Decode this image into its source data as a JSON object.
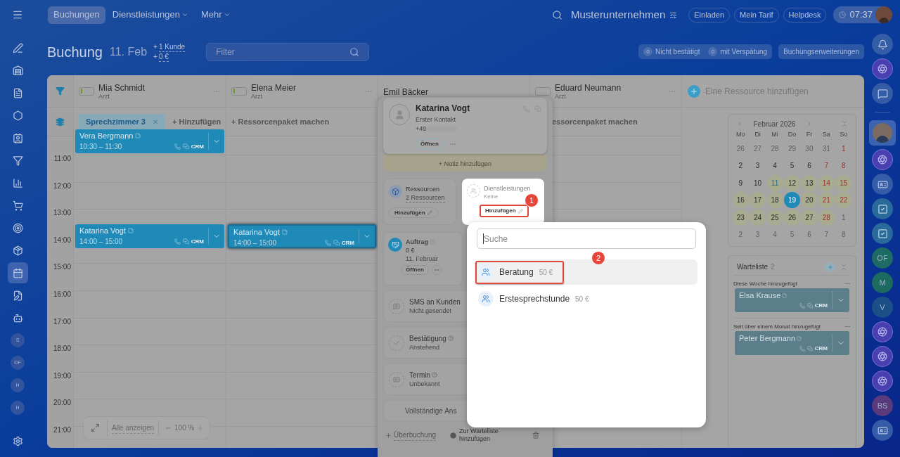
{
  "top_bar": {
    "tabs": [
      {
        "label": "Buchungen",
        "selected": true,
        "has_menu": false
      },
      {
        "label": "Dienstleistungen",
        "selected": false,
        "has_menu": true
      },
      {
        "label": "Mehr",
        "selected": false,
        "has_menu": true
      }
    ],
    "company": "Musterunternehmen",
    "buttons": [
      "Einladen",
      "Mein Tarif",
      "Helpdesk"
    ],
    "clock": "07:37"
  },
  "left_nav": [
    {
      "kind": "icon",
      "selected": false
    },
    {
      "kind": "icon",
      "selected": false
    },
    {
      "kind": "icon",
      "selected": false
    },
    {
      "kind": "icon",
      "selected": false
    },
    {
      "kind": "icon",
      "selected": false
    },
    {
      "kind": "icon",
      "selected": false
    },
    {
      "kind": "icon",
      "selected": false
    },
    {
      "kind": "icon",
      "selected": false
    },
    {
      "kind": "icon",
      "selected": false
    },
    {
      "kind": "icon",
      "selected": false
    },
    {
      "kind": "icon",
      "selected": true
    },
    {
      "kind": "icon",
      "selected": false
    },
    {
      "kind": "icon",
      "selected": false
    },
    {
      "kind": "avatar",
      "label": "S",
      "selected": false
    },
    {
      "kind": "avatar",
      "label": "DF",
      "selected": false
    },
    {
      "kind": "avatar",
      "label": "H",
      "selected": false
    },
    {
      "kind": "avatar",
      "label": "H",
      "selected": false
    }
  ],
  "right_nav": [
    {
      "kind": "bell",
      "selected": false
    },
    {
      "kind": "swirl",
      "selected": false
    },
    {
      "kind": "chat",
      "selected": false
    },
    {
      "kind": "divider"
    },
    {
      "kind": "person",
      "selected": true
    },
    {
      "kind": "swirl",
      "selected": false
    },
    {
      "kind": "card",
      "selected": false
    },
    {
      "kind": "task",
      "selected": false
    },
    {
      "kind": "task",
      "selected": false
    },
    {
      "kind": "avatar",
      "label": "OF",
      "color": "#1d6b62",
      "selected": false
    },
    {
      "kind": "avatar",
      "label": "M",
      "color": "#1d6a5e",
      "selected": false
    },
    {
      "kind": "avatar",
      "label": "V",
      "color": "#1c4f86",
      "selected": false
    },
    {
      "kind": "swirl",
      "selected": false
    },
    {
      "kind": "swirl",
      "selected": false
    },
    {
      "kind": "swirl",
      "selected": false
    },
    {
      "kind": "avatar",
      "label": "BS",
      "color": "#5a3a7a",
      "selected": false
    },
    {
      "kind": "card",
      "selected": false
    }
  ],
  "header": {
    "title": "Buchung",
    "date": "11. Feb",
    "stats": [
      {
        "prefix": "+",
        "value": "1 Kunde"
      },
      {
        "prefix": "+",
        "value": "0 €"
      }
    ],
    "filter_placeholder": "Filter",
    "counters": [
      {
        "count": "0",
        "label": "Nicht bestätigt"
      },
      {
        "count": "0",
        "label": "mit Verspätung"
      }
    ],
    "extensions_button": "Buchungserweiterungen"
  },
  "schedule": {
    "resources": [
      {
        "name": "Mia Schmidt",
        "role": "Arzt",
        "level": 0.12,
        "events": [
          {
            "name": "Vera Bergmann",
            "time": "10:30 – 11:30",
            "crm": "CRM",
            "selected": false
          },
          {
            "name": "Katarina Vogt",
            "time": "14:00 – 15:00",
            "crm": "CRM",
            "selected": false
          }
        ]
      },
      {
        "name": "Elena Meier",
        "role": "Arzt",
        "level": 0.12,
        "package_text": "+ Ressorcenpaket machen",
        "events": [
          {
            "name": "Katarina Vogt",
            "time": "14:00 – 15:00",
            "crm": "CRM",
            "selected": true
          }
        ]
      },
      {
        "name": "Emil Bäcker"
      },
      {
        "name": "Eduard Neumann",
        "role": "Arzt",
        "package_text": "essorcenpaket machen"
      }
    ],
    "package_chip": "Sprechzimmer 3",
    "chip_close": "✕",
    "add_to_package": "+ Hinzufügen",
    "add_resource": "Eine Ressource hinzufügen",
    "times": [
      "11:00",
      "12:00",
      "13:00",
      "14:00",
      "15:00",
      "16:00",
      "17:00",
      "18:00",
      "19:00",
      "20:00",
      "21:00"
    ],
    "show_all": "Alle anzeigen",
    "zoom": "100 %"
  },
  "calendar": {
    "title": "Februar 2026",
    "weekdays": [
      "Mo",
      "Di",
      "Mi",
      "Do",
      "Fr",
      "Sa",
      "So"
    ],
    "days": [
      {
        "day": "26",
        "outside": true,
        "busy": false,
        "today": false,
        "selected": false
      },
      {
        "day": "27",
        "outside": true,
        "busy": false,
        "today": false,
        "selected": false
      },
      {
        "day": "28",
        "outside": true,
        "busy": false,
        "today": false,
        "selected": false
      },
      {
        "day": "29",
        "outside": true,
        "busy": false,
        "today": false,
        "selected": false
      },
      {
        "day": "30",
        "outside": true,
        "busy": false,
        "today": false,
        "selected": false
      },
      {
        "day": "31",
        "outside": true,
        "busy": false,
        "today": false,
        "selected": false
      },
      {
        "day": "1",
        "outside": false,
        "busy": false,
        "today": false,
        "selected": false
      },
      {
        "day": "2",
        "outside": false,
        "busy": false,
        "today": false,
        "selected": false
      },
      {
        "day": "3",
        "outside": false,
        "busy": false,
        "today": false,
        "selected": false
      },
      {
        "day": "4",
        "outside": false,
        "busy": false,
        "today": false,
        "selected": false
      },
      {
        "day": "5",
        "outside": false,
        "busy": false,
        "today": false,
        "selected": false
      },
      {
        "day": "6",
        "outside": false,
        "busy": false,
        "today": false,
        "selected": false
      },
      {
        "day": "7",
        "outside": false,
        "busy": false,
        "today": false,
        "selected": false
      },
      {
        "day": "8",
        "outside": false,
        "busy": false,
        "today": false,
        "selected": false
      },
      {
        "day": "9",
        "outside": false,
        "busy": false,
        "today": false,
        "selected": false
      },
      {
        "day": "10",
        "outside": false,
        "busy": false,
        "today": false,
        "selected": false
      },
      {
        "day": "11",
        "outside": false,
        "busy": true,
        "today": true,
        "selected": false
      },
      {
        "day": "12",
        "outside": false,
        "busy": true,
        "today": false,
        "selected": false
      },
      {
        "day": "13",
        "outside": false,
        "busy": true,
        "today": false,
        "selected": false
      },
      {
        "day": "14",
        "outside": false,
        "busy": true,
        "today": false,
        "selected": false
      },
      {
        "day": "15",
        "outside": false,
        "busy": true,
        "today": false,
        "selected": false
      },
      {
        "day": "16",
        "outside": false,
        "busy": true,
        "today": false,
        "selected": false
      },
      {
        "day": "17",
        "outside": false,
        "busy": true,
        "today": false,
        "selected": false
      },
      {
        "day": "18",
        "outside": false,
        "busy": true,
        "today": false,
        "selected": false
      },
      {
        "day": "19",
        "outside": false,
        "busy": false,
        "today": false,
        "selected": true
      },
      {
        "day": "20",
        "outside": false,
        "busy": true,
        "today": false,
        "selected": false
      },
      {
        "day": "21",
        "outside": false,
        "busy": true,
        "today": false,
        "selected": false
      },
      {
        "day": "22",
        "outside": false,
        "busy": true,
        "today": false,
        "selected": false
      },
      {
        "day": "23",
        "outside": false,
        "busy": true,
        "today": false,
        "selected": false
      },
      {
        "day": "24",
        "outside": false,
        "busy": true,
        "today": false,
        "selected": false
      },
      {
        "day": "25",
        "outside": false,
        "busy": true,
        "today": false,
        "selected": false
      },
      {
        "day": "26",
        "outside": false,
        "busy": true,
        "today": false,
        "selected": false
      },
      {
        "day": "27",
        "outside": false,
        "busy": true,
        "today": false,
        "selected": false
      },
      {
        "day": "28",
        "outside": false,
        "busy": true,
        "today": false,
        "selected": false
      },
      {
        "day": "1",
        "outside": true,
        "busy": false,
        "today": false,
        "selected": false
      },
      {
        "day": "2",
        "outside": true,
        "busy": false,
        "today": false,
        "selected": false
      },
      {
        "day": "3",
        "outside": true,
        "busy": false,
        "today": false,
        "selected": false
      },
      {
        "day": "4",
        "outside": true,
        "busy": false,
        "today": false,
        "selected": false
      },
      {
        "day": "5",
        "outside": true,
        "busy": false,
        "today": false,
        "selected": false
      },
      {
        "day": "6",
        "outside": true,
        "busy": false,
        "today": false,
        "selected": false
      },
      {
        "day": "7",
        "outside": true,
        "busy": false,
        "today": false,
        "selected": false
      },
      {
        "day": "8",
        "outside": true,
        "busy": false,
        "today": false,
        "selected": false
      }
    ]
  },
  "waitlist": {
    "title": "Warteliste",
    "count": "2",
    "groups": [
      {
        "label": "Diese Woche hinzugefügt",
        "items": [
          {
            "name": "Elsa Krause",
            "crm": "CRM"
          }
        ]
      },
      {
        "label": "Seit über einem Monat hinzugefügt",
        "items": [
          {
            "name": "Peter Bergmann",
            "crm": "CRM"
          }
        ]
      }
    ]
  },
  "booking_popup": {
    "client": {
      "name": "Katarina Vogt",
      "subtitle": "Erster Kontakt",
      "phone": "+49",
      "open_button": "Öffnen"
    },
    "note_button": "+ Notiz hinzufügen",
    "resources_tile": {
      "title": "Ressourcen",
      "value": "2 Ressourcen",
      "button": "Hinzufügen"
    },
    "services_tile": {
      "title": "Dienstleistungen",
      "value": "Keine",
      "button": "Hinzufügen",
      "callout": "1"
    },
    "order_tile": {
      "title": "Auftrag",
      "amount": "0 €",
      "date": "11. Februar",
      "button": "Öffnen"
    },
    "rows": [
      {
        "kind": "sms",
        "title": "SMS an Kunden",
        "status": "Nicht gesendet"
      },
      {
        "kind": "confirm",
        "title": "Bestätigung",
        "status": "Anstehend"
      },
      {
        "kind": "appointment",
        "title": "Termin",
        "status": "Unbekannt"
      }
    ],
    "full_view": "Vollständige Ans",
    "overbook": "Überbuchung",
    "waitlist_link": "Zur Warteliste hinzufügen"
  },
  "service_dropdown": {
    "search_placeholder": "Suche",
    "items": [
      {
        "name": "Beratung",
        "price": "50 €",
        "selected": true,
        "callout": "2"
      },
      {
        "name": "Erstesprechstunde",
        "price": "50 €",
        "selected": false
      }
    ]
  }
}
